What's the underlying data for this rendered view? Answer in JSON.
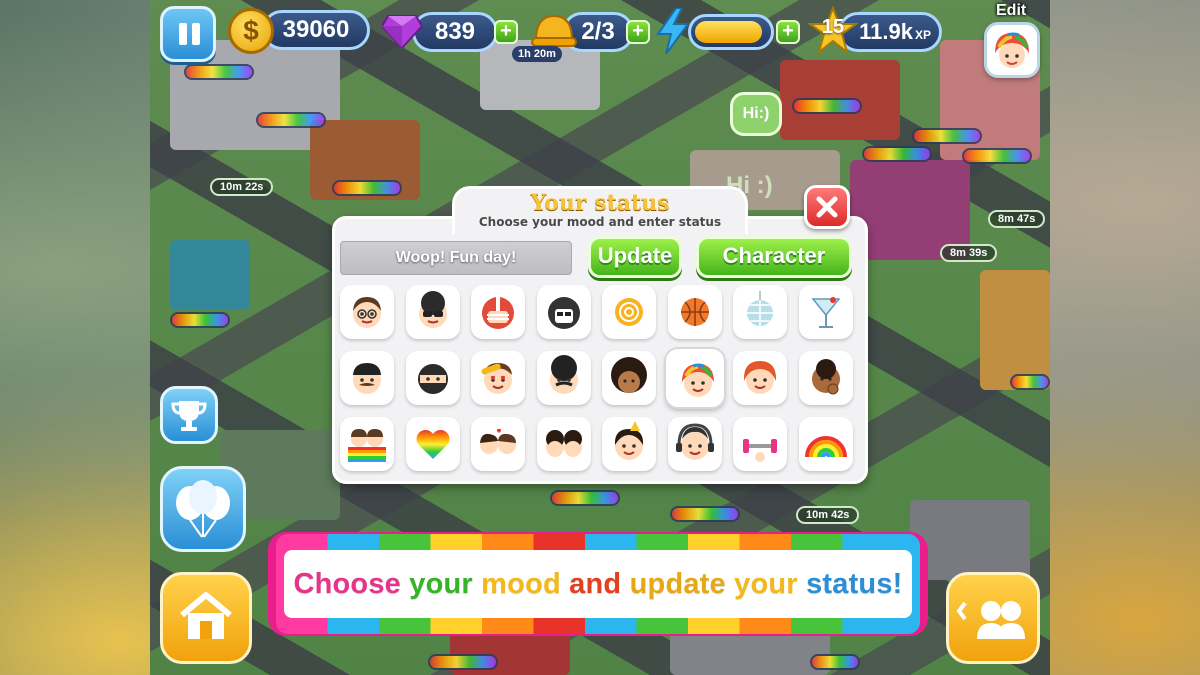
{
  "hud": {
    "coins": "39060",
    "coin_symbol": "$",
    "gems": "839",
    "builders": "2/3",
    "builder_timer": "1h 20m",
    "energy_level": 0.9,
    "level": "15",
    "xp": "11.9k",
    "xp_unit": "XP",
    "edit_label": "Edit",
    "plus": "+"
  },
  "map": {
    "timers": [
      "10m 22s",
      "8m 47s",
      "8m 39s",
      "10m 42s"
    ],
    "speech_bubble": "Hi:)",
    "floor_text": "Hi :)"
  },
  "dialog": {
    "title": "Your status",
    "subtitle": "Choose your mood and enter status",
    "status_text": "Woop! Fun day!",
    "update_label": "Update",
    "character_label": "Character",
    "selected_index": 13,
    "moods": [
      "glasses-guy",
      "sunglasses-guy",
      "football-helmet",
      "hockey-helmet",
      "sun",
      "basketball",
      "disco-ball",
      "cocktail",
      "mustache-biker",
      "masked-ninja",
      "heart-eyes",
      "mustache-afro",
      "afro",
      "rainbow-hair",
      "red-hair",
      "thinking-guy",
      "rainbow-couple",
      "rainbow-heart",
      "kissing-couple",
      "couple",
      "party-girl",
      "headphones-guy",
      "dumbbell",
      "rainbow"
    ]
  },
  "banner": {
    "words": [
      "Choose",
      "your",
      "mood",
      "and",
      "update",
      "your",
      "status!"
    ]
  },
  "colors": {
    "green_button": "#45b41c",
    "close_red": "#dd2a2a",
    "hud_blue": "#223a63",
    "banner_pink": "#e91e8c"
  }
}
